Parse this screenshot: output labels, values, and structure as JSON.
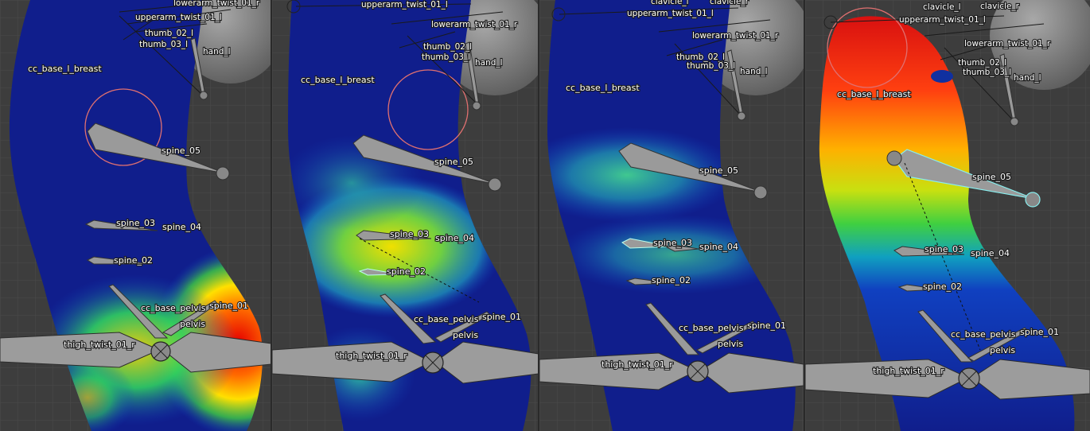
{
  "viewports": [
    {
      "labels": {
        "cc_base_l_breast": "cc_base_l_breast",
        "spine_05": "spine_05",
        "spine_03": "spine_03",
        "spine_04": "spine_04",
        "spine_02": "spine_02",
        "cc_base_pelvis": "cc_base_pelvis",
        "spine_01": "spine_01",
        "pelvis": "pelvis",
        "thigh_twist_01_r": "thigh_twist_01_r",
        "hand_l": "hand_l",
        "lowerarm_twist_01": "lowerarm_twist_01_r",
        "thumb_02": "thumb_02_l",
        "thumb_03": "thumb_03_l",
        "upperarm_twist_01": "upperarm_twist_01_l"
      }
    },
    {
      "labels": {
        "cc_base_l_breast": "cc_base_l_breast",
        "spine_05": "spine_05",
        "spine_03": "spine_03",
        "spine_04": "spine_04",
        "spine_02": "spine_02",
        "cc_base_pelvis": "cc_base_pelvis",
        "spine_01": "spine_01",
        "pelvis": "pelvis",
        "thigh_twist_01_r": "thigh_twist_01_r",
        "hand_l": "hand_l",
        "lowerarm_twist_01": "lowerarm_twist_01_r",
        "thumb_02": "thumb_02_l",
        "thumb_03": "thumb_03_l",
        "upperarm_twist_01": "upperarm_twist_01_l"
      }
    },
    {
      "labels": {
        "cc_base_l_breast": "cc_base_l_breast",
        "spine_05": "spine_05",
        "spine_03": "spine_03",
        "spine_04": "spine_04",
        "spine_02": "spine_02",
        "cc_base_pelvis": "cc_base_pelvis",
        "spine_01": "spine_01",
        "pelvis": "pelvis",
        "thigh_twist_01_r": "thigh_twist_01_r",
        "hand_l": "hand_l",
        "lowerarm_twist_01": "lowerarm_twist_01_r",
        "thumb_02": "thumb_02_l",
        "thumb_03": "thumb_03_l",
        "upperarm_twist_01": "upperarm_twist_01_l",
        "clavicle_l": "clavicle_l",
        "clavicle_r": "clavicle_r"
      }
    },
    {
      "labels": {
        "cc_base_l_breast": "cc_base_l_breast",
        "spine_05": "spine_05",
        "spine_03": "spine_03",
        "spine_04": "spine_04",
        "spine_02": "spine_02",
        "cc_base_pelvis": "cc_base_pelvis",
        "spine_01": "spine_01",
        "pelvis": "pelvis",
        "thigh_twist_01_r": "thigh_twist_01_r",
        "hand_l": "hand_l",
        "lowerarm_twist_01": "lowerarm_twist_01_r",
        "thumb_02": "thumb_02_l",
        "thumb_03": "thumb_03_l",
        "upperarm_twist_01": "upperarm_twist_01_l",
        "clavicle_l": "clavicle_l",
        "clavicle_r": "clavicle_r"
      }
    }
  ]
}
